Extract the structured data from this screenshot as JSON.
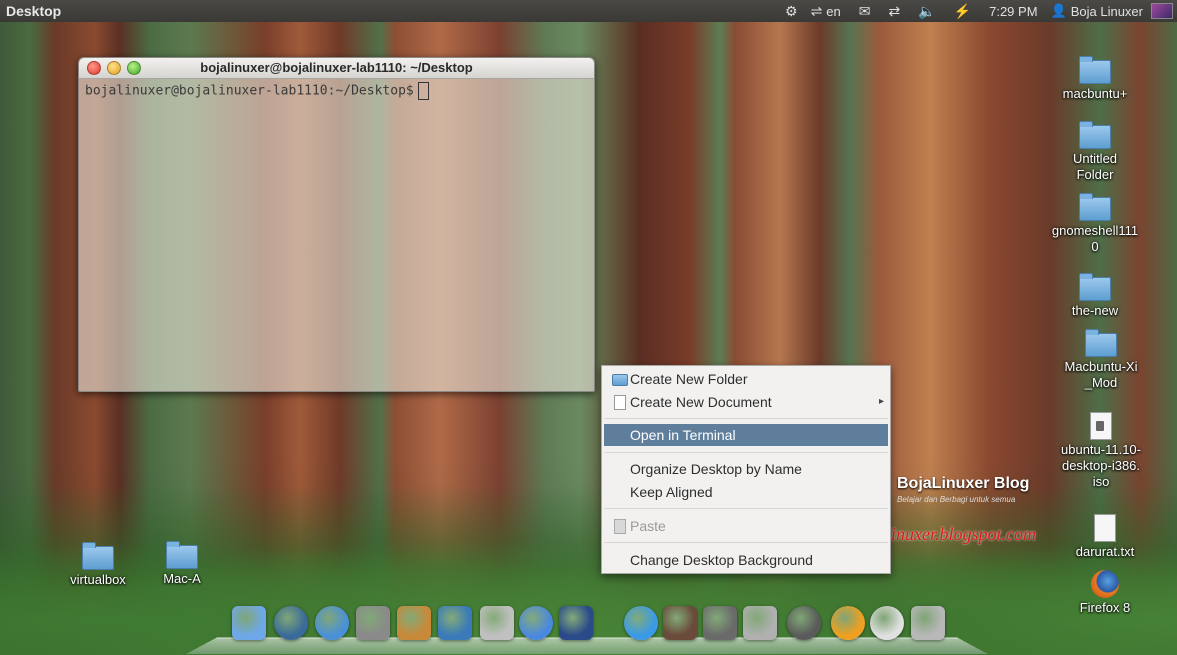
{
  "top_panel": {
    "app_title": "Desktop",
    "indicators": {
      "ubuntu_one": "⚙",
      "network": "⇌",
      "language": "en",
      "mail": "✉",
      "transfer": "⇄",
      "volume": "🔈",
      "power": "⚡",
      "clock": "7:29 PM",
      "user_icon": "👤",
      "user_name": "Boja Linuxer"
    }
  },
  "terminal": {
    "title": "bojalinuxer@bojalinuxer-lab1110: ~/Desktop",
    "prompt": "bojalinuxer@bojalinuxer-lab1110:~/Desktop$"
  },
  "desktop_icons": [
    {
      "label": "macbuntu+",
      "type": "folder"
    },
    {
      "label": "Untitled Folder",
      "type": "folder"
    },
    {
      "label": "gnomeshell1110",
      "type": "folder"
    },
    {
      "label": "the-new",
      "type": "folder"
    },
    {
      "label": "Macbuntu-Xi_Mod",
      "type": "folder"
    },
    {
      "label": "ubuntu-11.10-desktop-i386.iso",
      "type": "disc-file"
    },
    {
      "label": "darurat.txt",
      "type": "file"
    },
    {
      "label": "Firefox 8",
      "type": "firefox"
    },
    {
      "label": "virtualbox",
      "type": "folder"
    },
    {
      "label": "Mac-A",
      "type": "folder"
    }
  ],
  "context_menu": {
    "create_folder": "Create New Folder",
    "create_document": "Create New Document",
    "submenu_arrow": "▸",
    "open_terminal": "Open in Terminal",
    "organize": "Organize Desktop by Name",
    "keep_aligned": "Keep Aligned",
    "paste": "Paste",
    "change_background": "Change Desktop Background"
  },
  "watermark": {
    "name": "BojaLinuxer Blog",
    "tagline": "Belajar dan Berbagi untuk semua",
    "url": "http://bojalinuxer.blogspot.com"
  },
  "dock": {
    "items": [
      {
        "name": "finder-icon",
        "color": "#6fa8e8"
      },
      {
        "name": "time-machine-icon",
        "color": "#3a6a9a"
      },
      {
        "name": "safari-icon",
        "color": "#4a90d8"
      },
      {
        "name": "system-preferences-icon",
        "color": "#8a8a8a"
      },
      {
        "name": "software-center-icon",
        "color": "#c88a3a"
      },
      {
        "name": "feather-icon",
        "color": "#3a7ab8"
      },
      {
        "name": "calculator-icon",
        "color": "#c0c0c0"
      },
      {
        "name": "ichat-icon",
        "color": "#4a88e0"
      },
      {
        "name": "imovie-icon",
        "color": "#2a4a8a"
      },
      {
        "name": "itunes-icon",
        "color": "#3a9ae8"
      },
      {
        "name": "photo-booth-icon",
        "color": "#6a4a3a"
      },
      {
        "name": "apple-icon",
        "color": "#6a6a6a"
      },
      {
        "name": "disk-utility-icon",
        "color": "#b0b0b0"
      },
      {
        "name": "power-icon",
        "color": "#5a5a5a"
      },
      {
        "name": "weather-icon",
        "color": "#f0a020"
      },
      {
        "name": "clock-icon",
        "color": "#e0e0e0"
      },
      {
        "name": "trash-icon",
        "color": "#b8b8b8"
      }
    ]
  }
}
